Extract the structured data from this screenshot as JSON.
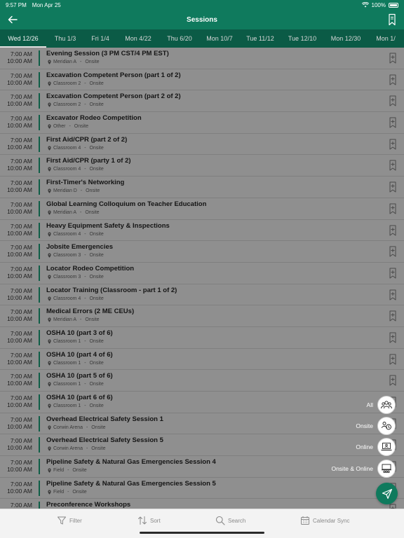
{
  "status": {
    "time": "9:57 PM",
    "date": "Mon Apr 25",
    "battery": "100%"
  },
  "header": {
    "title": "Sessions"
  },
  "tabs": [
    {
      "label": "Wed 12/26",
      "active": true
    },
    {
      "label": "Thu 1/3"
    },
    {
      "label": "Fri 1/4"
    },
    {
      "label": "Mon 4/22"
    },
    {
      "label": "Thu 6/20"
    },
    {
      "label": "Mon 10/7"
    },
    {
      "label": "Tue 11/12"
    },
    {
      "label": "Tue 12/10"
    },
    {
      "label": "Mon 12/30"
    },
    {
      "label": "Mon 1/"
    }
  ],
  "sessions": [
    {
      "start": "7:00 AM",
      "end": "10:00 AM",
      "title": "Evening Session (3 PM CST/4 PM EST)",
      "location": "Meridian A",
      "mode": "Onsite"
    },
    {
      "start": "7:00 AM",
      "end": "10:00 AM",
      "title": "Excavation Competent Person (part 1 of 2)",
      "location": "Classroom 2",
      "mode": "Onsite"
    },
    {
      "start": "7:00 AM",
      "end": "10:00 AM",
      "title": "Excavation Competent Person (part 2 of 2)",
      "location": "Classroom 2",
      "mode": "Onsite"
    },
    {
      "start": "7:00 AM",
      "end": "10:00 AM",
      "title": "Excavator Rodeo Competition",
      "location": "Other",
      "mode": "Onsite"
    },
    {
      "start": "7:00 AM",
      "end": "10:00 AM",
      "title": "First Aid/CPR (part 2 of 2)",
      "location": "Classroom 4",
      "mode": "Onsite"
    },
    {
      "start": "7:00 AM",
      "end": "10:00 AM",
      "title": "First Aid/CPR (party 1 of 2)",
      "location": "Classroom 4",
      "mode": "Onsite"
    },
    {
      "start": "7:00 AM",
      "end": "10:00 AM",
      "title": "First-Timer's Networking",
      "location": "Meridian D",
      "mode": "Onsite"
    },
    {
      "start": "7:00 AM",
      "end": "10:00 AM",
      "title": "Global Learning Colloquium on Teacher Education",
      "location": "Meridian A",
      "mode": "Onsite"
    },
    {
      "start": "7:00 AM",
      "end": "10:00 AM",
      "title": "Heavy Equipment Safety & Inspections",
      "location": "Classroom 4",
      "mode": "Onsite"
    },
    {
      "start": "7:00 AM",
      "end": "10:00 AM",
      "title": "Jobsite Emergencies",
      "location": "Classroom 3",
      "mode": "Onsite"
    },
    {
      "start": "7:00 AM",
      "end": "10:00 AM",
      "title": "Locator Rodeo Competition",
      "location": "Classroom 3",
      "mode": "Onsite"
    },
    {
      "start": "7:00 AM",
      "end": "10:00 AM",
      "title": "Locator Training (Classroom - part 1 of 2)",
      "location": "Classroom 4",
      "mode": "Onsite"
    },
    {
      "start": "7:00 AM",
      "end": "10:00 AM",
      "title": "Medical Errors (2 ME CEUs)",
      "location": "Meridian A",
      "mode": "Onsite"
    },
    {
      "start": "7:00 AM",
      "end": "10:00 AM",
      "title": "OSHA 10 (part 3 of 6)",
      "location": "Classroom 1",
      "mode": "Onsite"
    },
    {
      "start": "7:00 AM",
      "end": "10:00 AM",
      "title": "OSHA 10 (part 4 of 6)",
      "location": "Classroom 1",
      "mode": "Onsite"
    },
    {
      "start": "7:00 AM",
      "end": "10:00 AM",
      "title": "OSHA 10 (part 5 of 6)",
      "location": "Classroom 1",
      "mode": "Onsite"
    },
    {
      "start": "7:00 AM",
      "end": "10:00 AM",
      "title": "OSHA 10 (part 6 of 6)",
      "location": "Classroom 1",
      "mode": "Onsite"
    },
    {
      "start": "7:00 AM",
      "end": "10:00 AM",
      "title": "Overhead Electrical Safety Session 1",
      "location": "Corwin Arena",
      "mode": "Onsite"
    },
    {
      "start": "7:00 AM",
      "end": "10:00 AM",
      "title": "Overhead Electrical Safety Session 5",
      "location": "Corwin Arena",
      "mode": "Onsite"
    },
    {
      "start": "7:00 AM",
      "end": "10:00 AM",
      "title": "Pipeline Safety & Natural Gas Emergencies Session 4",
      "location": "Field",
      "mode": "Onsite"
    },
    {
      "start": "7:00 AM",
      "end": "10:00 AM",
      "title": "Pipeline Safety & Natural Gas Emergencies Session 5",
      "location": "Field",
      "mode": "Onsite"
    },
    {
      "start": "7:00 AM",
      "end": "",
      "title": "Preconference Workshops",
      "location": "",
      "mode": ""
    }
  ],
  "fab_menu": [
    {
      "label": "All",
      "icon": "group-icon"
    },
    {
      "label": "Onsite",
      "icon": "people-location-icon"
    },
    {
      "label": "Online",
      "icon": "laptop-user-icon"
    },
    {
      "label": "Onsite & Online",
      "icon": "hybrid-icon"
    }
  ],
  "bottom": {
    "filter": "Filter",
    "sort": "Sort",
    "search": "Search",
    "calendar_sync": "Calendar Sync"
  },
  "colors": {
    "brand": "#0f7a5d",
    "brand_dark": "#0b5b46",
    "overlay": "#8f8f8f"
  }
}
